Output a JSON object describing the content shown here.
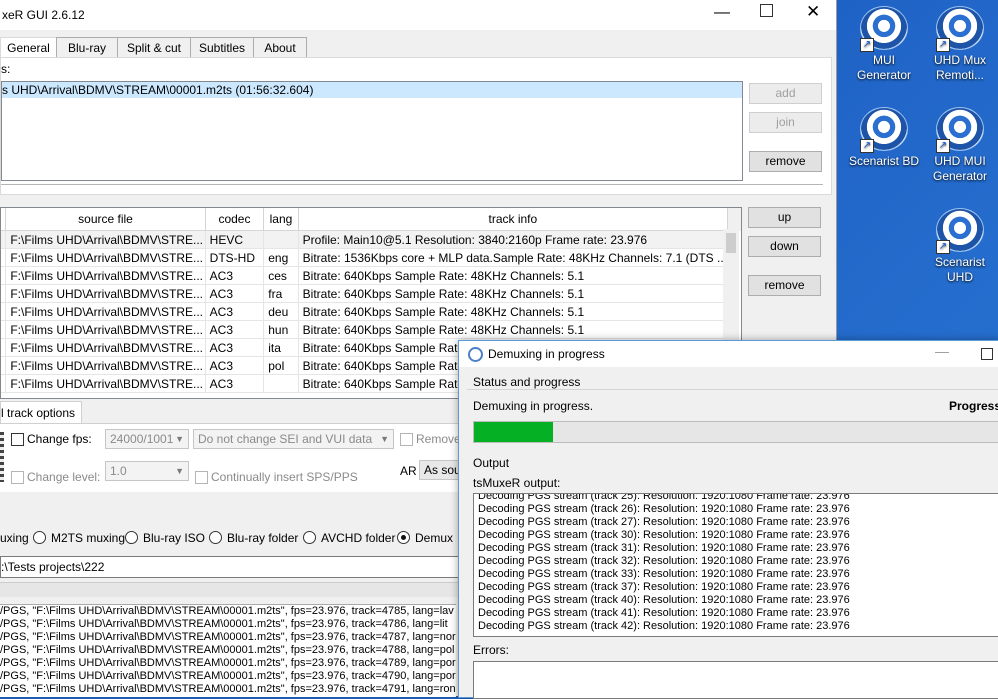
{
  "main_window": {
    "title": "xeR GUI 2.6.12",
    "tabs": [
      "General",
      "Blu-ray",
      "Split & cut",
      "Subtitles",
      "About"
    ],
    "sources_label": "s:",
    "source_entry": "s UHD\\Arrival\\BDMV\\STREAM\\00001.m2ts (01:56:32.604)",
    "buttons": {
      "add": "add",
      "join": "join",
      "remove": "remove",
      "up": "up",
      "down": "down",
      "remove2": "remove"
    },
    "tracks_table": {
      "headers": [
        "source file",
        "codec",
        "lang",
        "track info"
      ],
      "rows": [
        [
          "F:\\Films UHD\\Arrival\\BDMV\\STRE...",
          "HEVC",
          "",
          "Profile: Main10@5.1 Resolution: 3840:2160p Frame rate: 23.976"
        ],
        [
          "F:\\Films UHD\\Arrival\\BDMV\\STRE...",
          "DTS-HD",
          "eng",
          "Bitrate: 1536Kbps  core + MLP data.Sample Rate: 48KHz  Channels: 7.1 (DTS ..."
        ],
        [
          "F:\\Films UHD\\Arrival\\BDMV\\STRE...",
          "AC3",
          "ces",
          "Bitrate: 640Kbps Sample Rate: 48KHz Channels: 5.1"
        ],
        [
          "F:\\Films UHD\\Arrival\\BDMV\\STRE...",
          "AC3",
          "fra",
          "Bitrate: 640Kbps Sample Rate: 48KHz Channels: 5.1"
        ],
        [
          "F:\\Films UHD\\Arrival\\BDMV\\STRE...",
          "AC3",
          "deu",
          "Bitrate: 640Kbps Sample Rate: 48KHz Channels: 5.1"
        ],
        [
          "F:\\Films UHD\\Arrival\\BDMV\\STRE...",
          "AC3",
          "hun",
          "Bitrate: 640Kbps Sample Rate: 48KHz Channels: 5.1"
        ],
        [
          "F:\\Films UHD\\Arrival\\BDMV\\STRE...",
          "AC3",
          "ita",
          "Bitrate: 640Kbps Sample Rate"
        ],
        [
          "F:\\Films UHD\\Arrival\\BDMV\\STRE...",
          "AC3",
          "pol",
          "Bitrate: 640Kbps Sample Rate"
        ],
        [
          "F:\\Films UHD\\Arrival\\BDMV\\STRE...",
          "AC3",
          "",
          "Bitrate: 640Kbps Sample Rate"
        ]
      ]
    },
    "track_options_tab": "l track options",
    "change_fps_label": "Change fps:",
    "fps_value": "24000/1001",
    "sei_value": "Do not change SEI and VUI data",
    "remove_label": "Remove",
    "change_level_label": "Change level:",
    "level_value": "1.0",
    "insert_sps_label": "Continually insert SPS/PPS",
    "ar_label": "AR",
    "ar_value": "As sour",
    "output_modes": [
      "uxing",
      "M2TS muxing",
      "Blu-ray ISO",
      "Blu-ray folder",
      "AVCHD folder",
      "Demux"
    ],
    "output_path": ":\\Tests projects\\222",
    "log_lines": [
      "/PGS, \"F:\\Films UHD\\Arrival\\BDMV\\STREAM\\00001.m2ts\", fps=23.976, track=4785, lang=lav",
      "/PGS, \"F:\\Films UHD\\Arrival\\BDMV\\STREAM\\00001.m2ts\", fps=23.976, track=4786, lang=lit",
      "/PGS, \"F:\\Films UHD\\Arrival\\BDMV\\STREAM\\00001.m2ts\", fps=23.976, track=4787, lang=nor",
      "/PGS, \"F:\\Films UHD\\Arrival\\BDMV\\STREAM\\00001.m2ts\", fps=23.976, track=4788, lang=pol",
      "/PGS, \"F:\\Films UHD\\Arrival\\BDMV\\STREAM\\00001.m2ts\", fps=23.976, track=4789, lang=por",
      "/PGS, \"F:\\Films UHD\\Arrival\\BDMV\\STREAM\\00001.m2ts\", fps=23.976, track=4790, lang=por",
      "/PGS, \"F:\\Films UHD\\Arrival\\BDMV\\STREAM\\00001.m2ts\", fps=23.976, track=4791, lang=ron"
    ]
  },
  "desktop_icons": [
    "MUI Generator",
    "UHD Mux Remoti...",
    "Scenarist BD",
    "UHD MUI Generator",
    "Scenarist UHD"
  ],
  "dialog": {
    "title": "Demuxing in progress",
    "status_group": "Status and progress",
    "status_text": "Demuxing in progress.",
    "progress_label": "Progress",
    "progress_fraction": 0.15,
    "output_group": "Output",
    "output_label": "tsMuxeR output:",
    "output_lines": [
      "Decoding PGS stream (track 25):  Resolution: 1920:1080  Frame rate: 23.976",
      "Decoding PGS stream (track 26):  Resolution: 1920:1080  Frame rate: 23.976",
      "Decoding PGS stream (track 27):  Resolution: 1920:1080  Frame rate: 23.976",
      "Decoding PGS stream (track 30):  Resolution: 1920:1080  Frame rate: 23.976",
      "Decoding PGS stream (track 31):  Resolution: 1920:1080  Frame rate: 23.976",
      "Decoding PGS stream (track 32):  Resolution: 1920:1080  Frame rate: 23.976",
      "Decoding PGS stream (track 33):  Resolution: 1920:1080  Frame rate: 23.976",
      "Decoding PGS stream (track 37):  Resolution: 1920:1080  Frame rate: 23.976",
      "Decoding PGS stream (track 40):  Resolution: 1920:1080  Frame rate: 23.976",
      "Decoding PGS stream (track 41):  Resolution: 1920:1080  Frame rate: 23.976",
      "Decoding PGS stream (track 42):  Resolution: 1920:1080  Frame rate: 23.976"
    ],
    "errors_label": "Errors:",
    "accent_color": "#06b025"
  }
}
